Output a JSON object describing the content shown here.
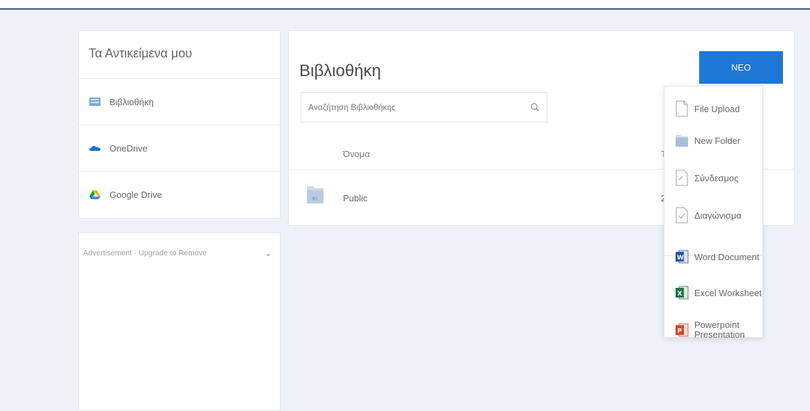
{
  "sidebar": {
    "title": "Τα Αντικείμενα μου",
    "items": [
      {
        "label": "Βιβλιοθήκη",
        "icon": "library-icon"
      },
      {
        "label": "OneDrive",
        "icon": "onedrive-icon"
      },
      {
        "label": "Google Drive",
        "icon": "google-drive-icon"
      }
    ]
  },
  "ad": {
    "label": "Advertisement · Upgrade to Remove",
    "toggle_icon": "chevron-down-icon"
  },
  "main": {
    "title": "Βιβλιοθήκη",
    "new_button": "ΝΕΟ",
    "search_placeholder": "Αναζήτηση Βιβλιοθήκης",
    "columns": {
      "name": "Όνομα",
      "cut": "T"
    },
    "rows": [
      {
        "name": "Public",
        "cut": "2",
        "icon": "folder-icon"
      }
    ]
  },
  "dropdown": {
    "items": [
      {
        "label": "File Upload",
        "icon": "file-icon"
      },
      {
        "label": "New Folder",
        "icon": "folder-icon"
      },
      {
        "label": "Σύνδεσμος",
        "icon": "link-icon"
      },
      {
        "label": "Διαγώνισμα",
        "icon": "quiz-icon"
      },
      {
        "label": "Word Document",
        "icon": "word-icon"
      },
      {
        "label": "Excel Worksheet",
        "icon": "excel-icon"
      },
      {
        "label": "Powerpoint Presentation",
        "icon": "powerpoint-icon"
      }
    ]
  },
  "colors": {
    "accent": "#1d78d6",
    "topbar_line": "#2f5597",
    "background": "#eef2f8"
  }
}
